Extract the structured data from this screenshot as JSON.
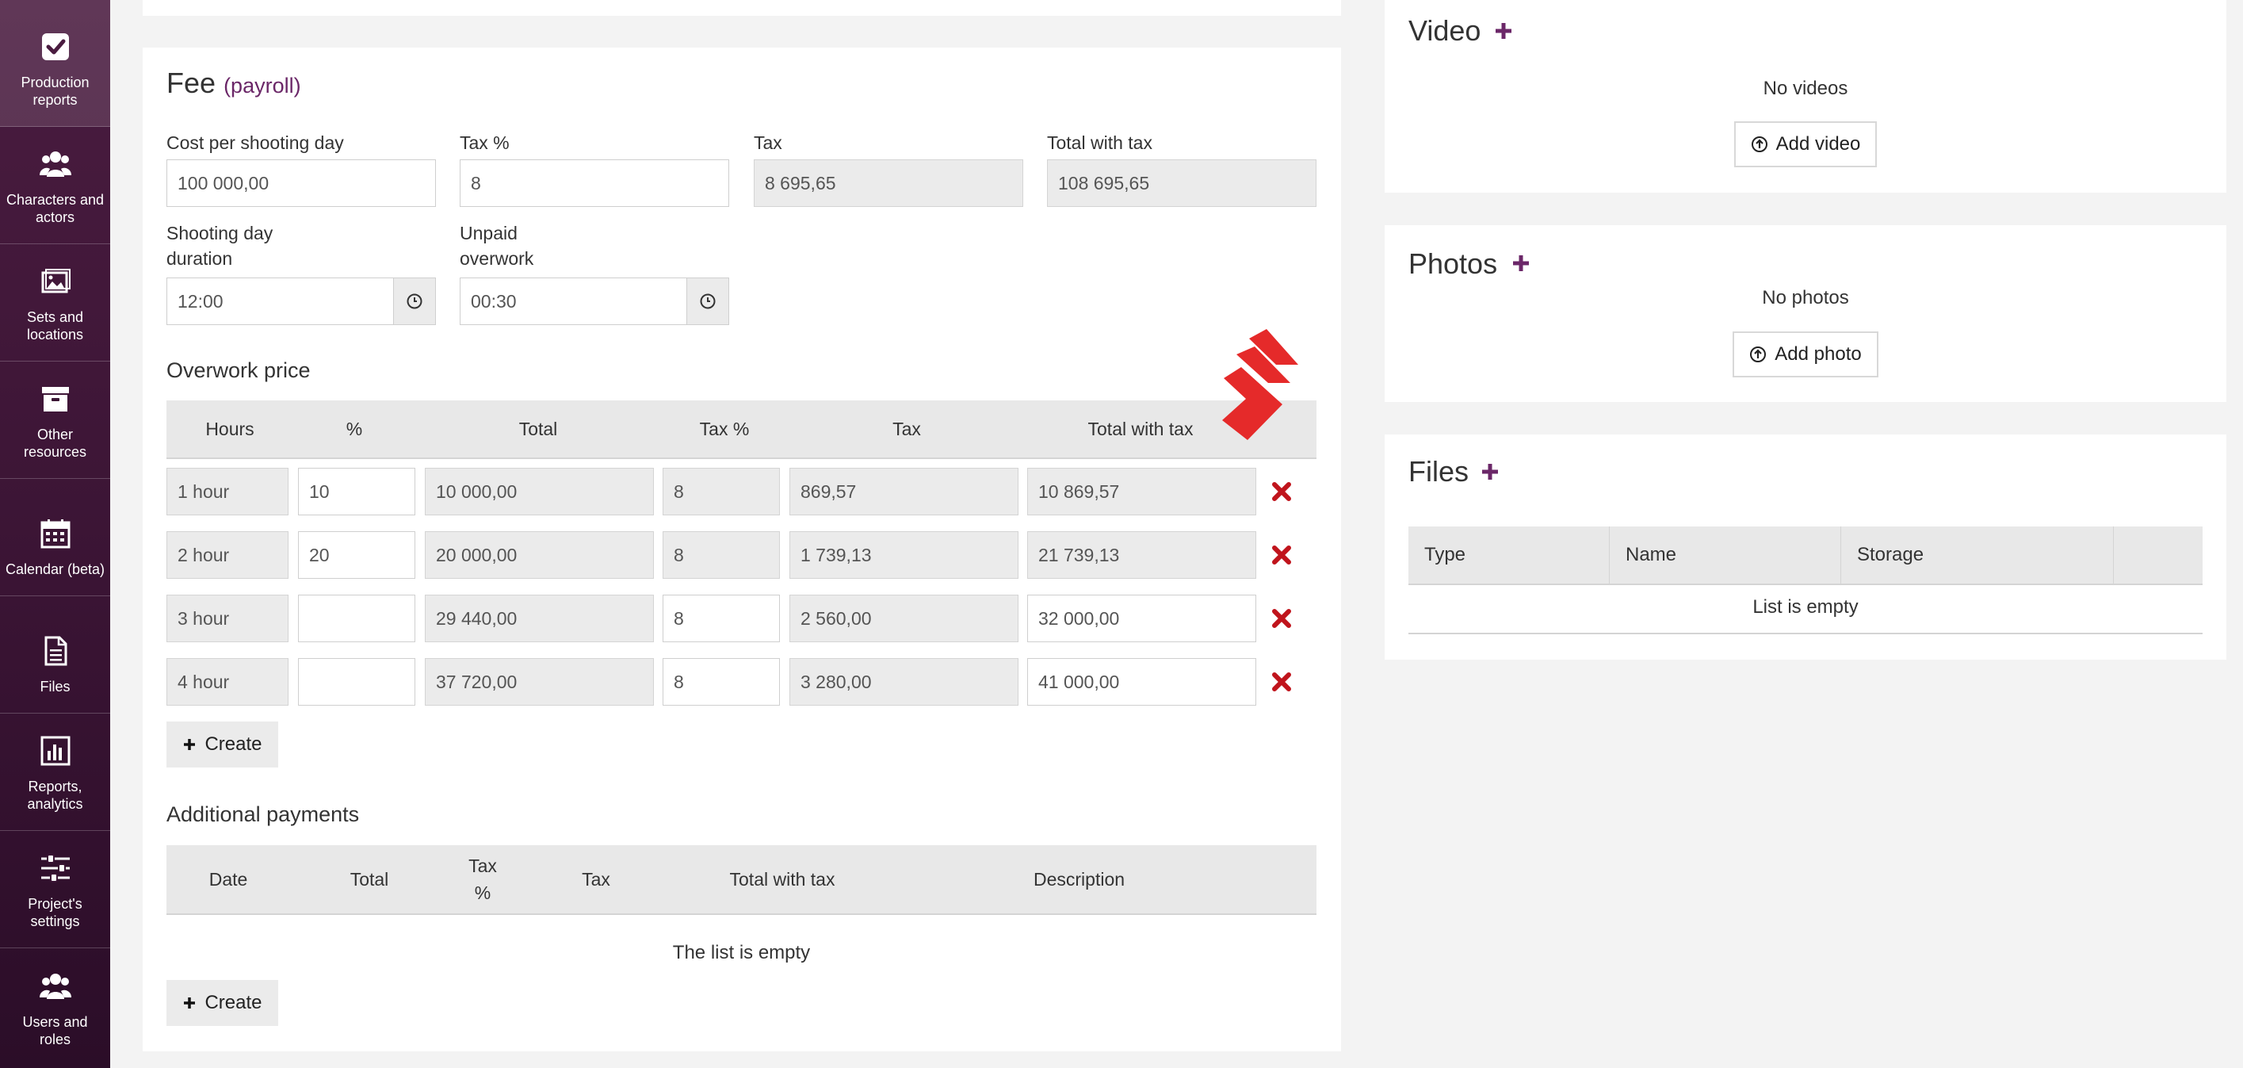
{
  "sidebar": {
    "items": [
      {
        "label": "Production reports",
        "icon": "checkbox-icon"
      },
      {
        "label": "Characters and actors",
        "icon": "users-icon"
      },
      {
        "label": "Sets and locations",
        "icon": "image-icon"
      },
      {
        "label": "Other resources",
        "icon": "archive-box-icon"
      },
      {
        "label": "Calendar (beta)",
        "icon": "calendar-icon"
      },
      {
        "label": "Files",
        "icon": "file-icon"
      },
      {
        "label": "Reports, analytics",
        "icon": "bar-chart-icon"
      },
      {
        "label": "Project's settings",
        "icon": "sliders-icon"
      },
      {
        "label": "Users and roles",
        "icon": "users-icon"
      }
    ]
  },
  "fee": {
    "title": "Fee",
    "subtitle": "(payroll)",
    "cost_label": "Cost per shooting day",
    "cost_value": "100 000,00",
    "taxp_label": "Tax %",
    "taxp_value": "8",
    "tax_label": "Tax",
    "tax_value": "8 695,65",
    "total_label": "Total with tax",
    "total_value": "108 695,65",
    "duration_label_1": "Shooting day",
    "duration_label_2": "duration",
    "duration_value": "12:00",
    "unpaid_label_1": "Unpaid",
    "unpaid_label_2": "overwork",
    "unpaid_value": "00:30"
  },
  "overwork": {
    "title": "Overwork price",
    "headers": [
      "Hours",
      "%",
      "Total",
      "Tax %",
      "Tax",
      "Total with tax"
    ],
    "rows": [
      {
        "hours": "1 hour",
        "pct": "10",
        "total": "10 000,00",
        "taxp": "8",
        "tax": "869,57",
        "total_tax": "10 869,57"
      },
      {
        "hours": "2 hour",
        "pct": "20",
        "total": "20 000,00",
        "taxp": "8",
        "tax": "1 739,13",
        "total_tax": "21 739,13"
      },
      {
        "hours": "3 hour",
        "pct": "",
        "total": "29 440,00",
        "taxp": "8",
        "tax": "2 560,00",
        "total_tax": "32 000,00"
      },
      {
        "hours": "4 hour",
        "pct": "",
        "total": "37 720,00",
        "taxp": "8",
        "tax": "3 280,00",
        "total_tax": "41 000,00"
      }
    ],
    "create_label": "Create"
  },
  "additional": {
    "title": "Additional payments",
    "headers": {
      "date": "Date",
      "total": "Total",
      "taxp_1": "Tax",
      "taxp_2": "%",
      "tax": "Tax",
      "total_tax": "Total with tax",
      "description": "Description"
    },
    "empty": "The list is empty",
    "create_label": "Create"
  },
  "video": {
    "title": "Video",
    "empty": "No videos",
    "add_label": "Add video"
  },
  "photos": {
    "title": "Photos",
    "empty": "No photos",
    "add_label": "Add photo"
  },
  "files": {
    "title": "Files",
    "headers": [
      "Type",
      "Name",
      "Storage"
    ],
    "empty": "List is empty"
  },
  "colors": {
    "accent": "#6b2768",
    "delete": "#c0141c",
    "sidebar": "#3a1434"
  }
}
